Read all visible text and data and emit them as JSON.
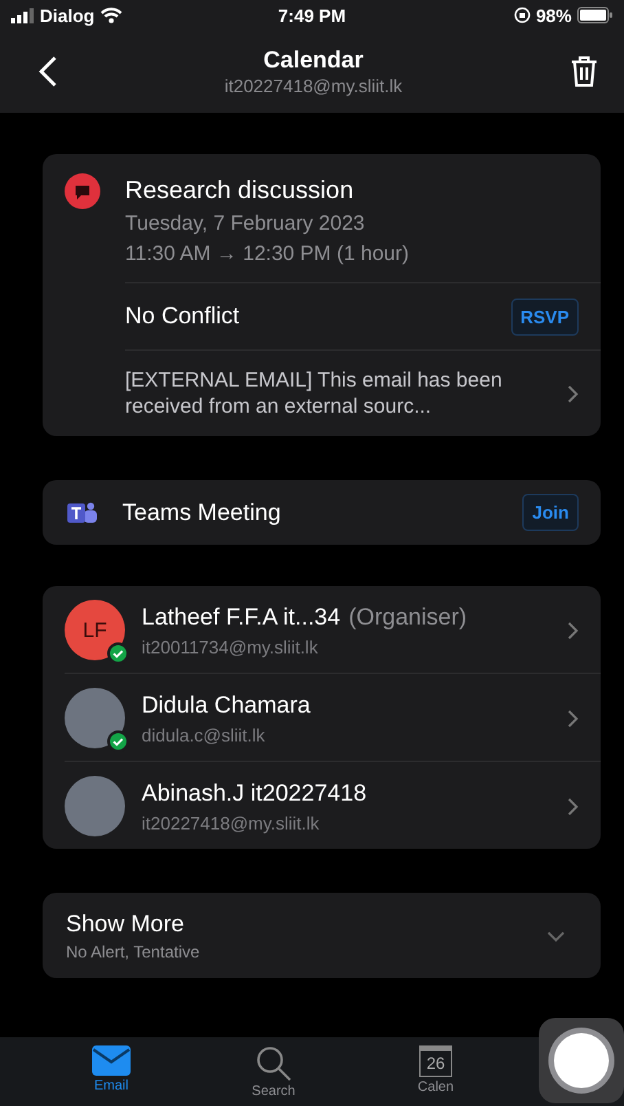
{
  "status_bar": {
    "carrier": "Dialog",
    "time": "7:49 PM",
    "battery": "98%"
  },
  "header": {
    "title": "Calendar",
    "subtitle": "it20227418@my.sliit.lk"
  },
  "event": {
    "title": "Research discussion",
    "date": "Tuesday, 7 February 2023",
    "time": "11:30 AM → 12:30 PM (1 hour)",
    "conflict": "No Conflict",
    "rsvp_button": "RSVP",
    "description": "[EXTERNAL EMAIL] This email has been received from an external sourc..."
  },
  "meeting": {
    "label": "Teams Meeting",
    "join_button": "Join"
  },
  "attendees": [
    {
      "name": "Latheef F.F.A it...34",
      "role": "(Organiser)",
      "email": "it20011734@my.sliit.lk",
      "kind": "initials",
      "initials": "LF",
      "accepted": true
    },
    {
      "name": "Didula Chamara",
      "email": "didula.c@sliit.lk",
      "kind": "photo",
      "accepted": true
    },
    {
      "name": "Abinash.J it20227418",
      "email": "it20227418@my.sliit.lk",
      "kind": "photo",
      "accepted": false
    }
  ],
  "show_more": {
    "title": "Show More",
    "subtitle": "No Alert, Tentative",
    "expanded": false
  },
  "tabs": [
    {
      "label": "Email",
      "kind": "mail",
      "selected": true
    },
    {
      "label": "Search",
      "kind": "search",
      "selected": false
    },
    {
      "label": "Calen",
      "kind": "calendar",
      "icon_text": "26",
      "selected": false
    }
  ]
}
